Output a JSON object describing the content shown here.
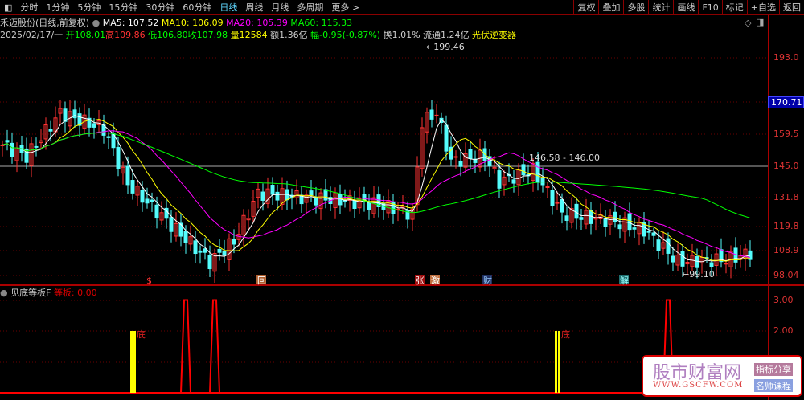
{
  "toolbar": {
    "tabs": [
      "分时",
      "1分钟",
      "5分钟",
      "15分钟",
      "30分钟",
      "60分钟",
      "日线",
      "周线",
      "月线",
      "多周期",
      "更多 >"
    ],
    "active": "日线",
    "right_buttons": [
      "复权",
      "叠加",
      "多股",
      "统计",
      "画线",
      "F10",
      "标记",
      "+自选",
      "返回"
    ]
  },
  "header": {
    "title": "禾迈股份(日线,前复权)",
    "ma5": "MA5: 107.52",
    "ma10": "MA10: 106.09",
    "ma20": "MA20: 105.39",
    "ma60": "MA60: 115.33",
    "date": "2025/02/17/一",
    "open": "开108.01",
    "high": "高109.86",
    "low": "低106.80",
    "close": "收107.98",
    "vol": "量12584",
    "amount": "额1.36亿",
    "change": "幅-0.95(-0.87%)",
    "turnover": "换1.01%",
    "float": "流通1.24亿",
    "sector": "光伏逆变器"
  },
  "colors": {
    "up": "#ff3232",
    "down": "#54fcfc",
    "ma5": "#ffffff",
    "ma10": "#ffff00",
    "ma20": "#ff00ff",
    "ma60": "#00ff00"
  },
  "axis": {
    "labels": [
      "193.0",
      "170.71",
      "159.5",
      "145.0",
      "131.8",
      "119.8",
      "108.9",
      "98.04"
    ],
    "current": "170.71",
    "ind_labels": [
      "3.00",
      "2.00"
    ]
  },
  "annotations": {
    "high": "199.46",
    "low": "99.10",
    "range": "146.58 - 146.00"
  },
  "markers": [
    "$",
    "回",
    "张",
    "激",
    "财",
    "解"
  ],
  "indicator": {
    "name": "见底等板F",
    "value_label": "等板: 0.00",
    "bottom_label": "底",
    "spikes": [
      38,
      44,
      138
    ],
    "bars": [
      27,
      115
    ]
  },
  "watermark": {
    "title": "股市财富网",
    "url": "WWW.GSCFW.COM",
    "tag1": "指标分享",
    "tag2": "名师课程"
  },
  "chart_data": {
    "type": "candlestick",
    "ylim": [
      98.04,
      199.46
    ],
    "close_keypoints": [
      [
        0,
        155
      ],
      [
        5,
        150
      ],
      [
        12,
        169
      ],
      [
        21,
        162
      ],
      [
        26,
        138
      ],
      [
        33,
        124
      ],
      [
        43,
        104
      ],
      [
        48,
        113
      ],
      [
        53,
        134
      ],
      [
        63,
        132
      ],
      [
        70,
        131
      ],
      [
        78,
        129
      ],
      [
        85,
        125
      ],
      [
        87,
        165
      ],
      [
        90,
        169
      ],
      [
        93,
        148
      ],
      [
        100,
        150
      ],
      [
        103,
        139
      ],
      [
        110,
        144
      ],
      [
        116,
        125
      ],
      [
        126,
        122
      ],
      [
        133,
        118
      ],
      [
        140,
        104
      ],
      [
        150,
        105
      ],
      [
        155,
        108
      ]
    ]
  }
}
